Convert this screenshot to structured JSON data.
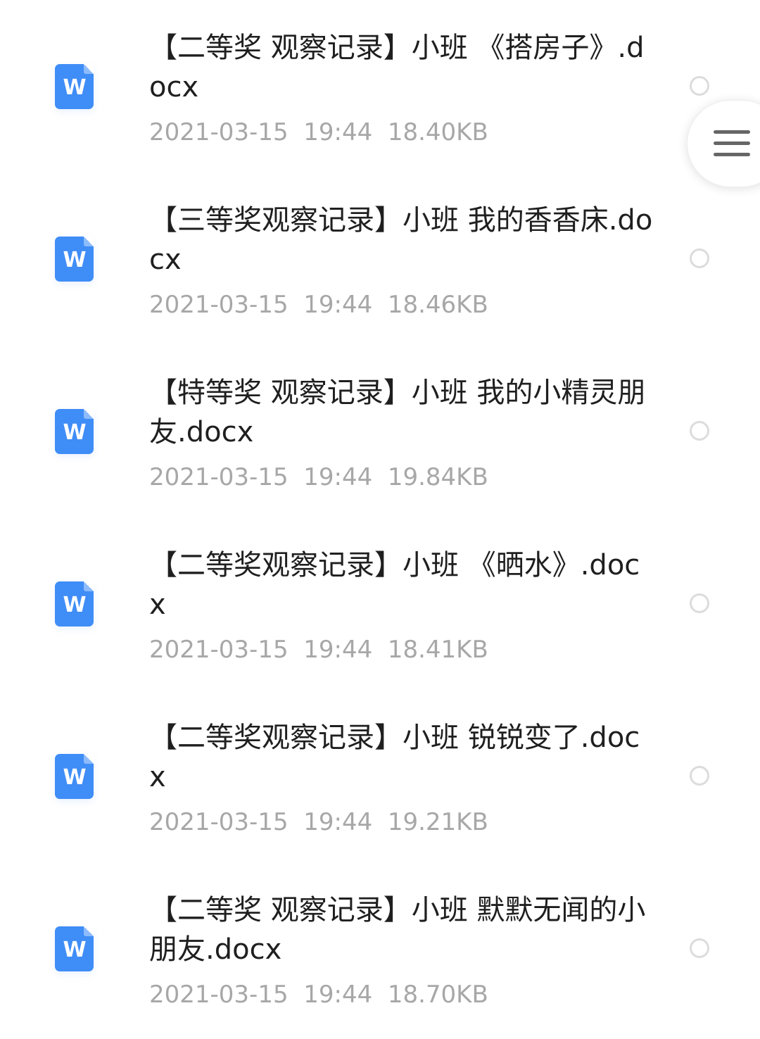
{
  "files": [
    {
      "icon": "word-doc-icon",
      "icon_letter": "W",
      "title": "【二等奖 观察记录】小班 《搭房子》.docx",
      "date": "2021-03-15",
      "time": "19:44",
      "size": "18.40KB"
    },
    {
      "icon": "word-doc-icon",
      "icon_letter": "W",
      "title": "【三等奖观察记录】小班 我的香香床.docx",
      "date": "2021-03-15",
      "time": "19:44",
      "size": "18.46KB"
    },
    {
      "icon": "word-doc-icon",
      "icon_letter": "W",
      "title": "【特等奖 观察记录】小班 我的小精灵朋友.docx",
      "date": "2021-03-15",
      "time": "19:44",
      "size": "19.84KB"
    },
    {
      "icon": "word-doc-icon",
      "icon_letter": "W",
      "title": "【二等奖观察记录】小班 《晒水》.docx",
      "date": "2021-03-15",
      "time": "19:44",
      "size": "18.41KB"
    },
    {
      "icon": "word-doc-icon",
      "icon_letter": "W",
      "title": "【二等奖观察记录】小班 锐锐变了.docx",
      "date": "2021-03-15",
      "time": "19:44",
      "size": "19.21KB"
    },
    {
      "icon": "word-doc-icon",
      "icon_letter": "W",
      "title": "【二等奖 观察记录】小班 默默无闻的小朋友.docx",
      "date": "2021-03-15",
      "time": "19:44",
      "size": "18.70KB"
    }
  ],
  "floating_menu": {
    "icon": "hamburger-menu-icon"
  },
  "colors": {
    "icon_blue": "#3f8df7",
    "title_text": "#1f1f1f",
    "meta_text": "#a7a7a7",
    "radio_border": "#dcdcdc"
  }
}
